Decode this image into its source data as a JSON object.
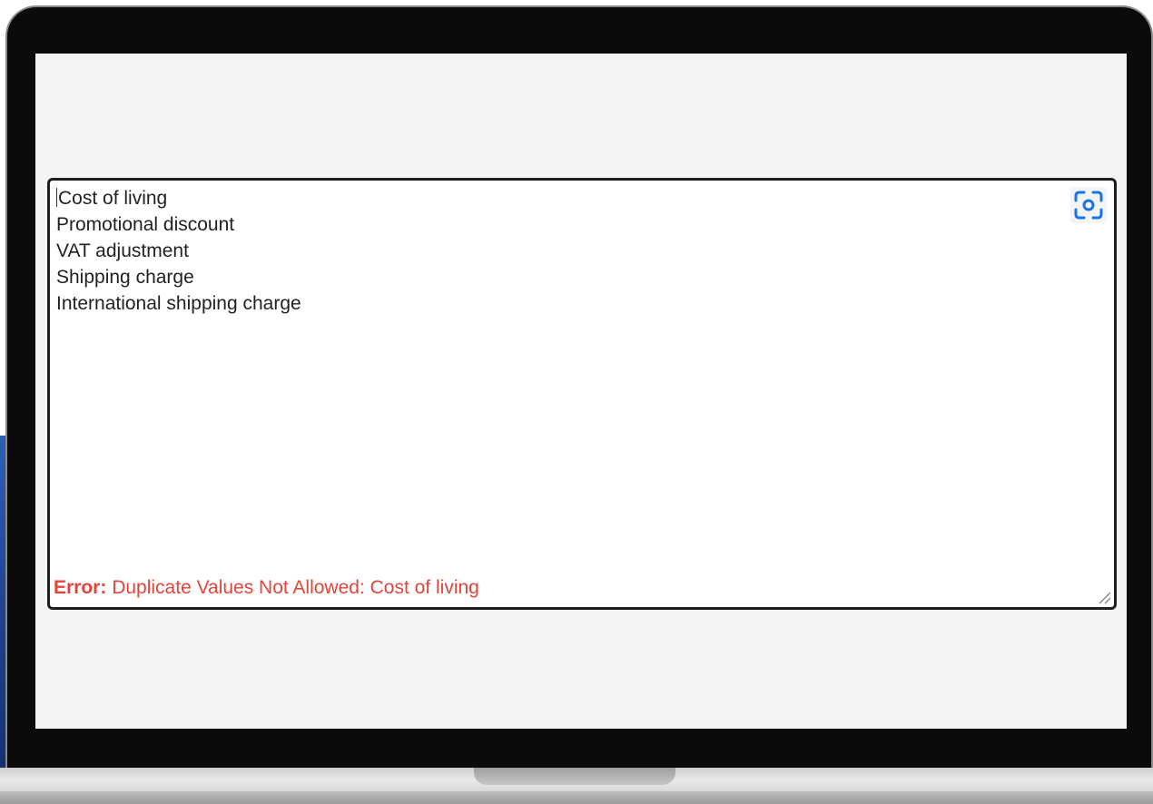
{
  "textarea": {
    "lines": [
      "Cost of living",
      "Promotional discount",
      "VAT adjustment",
      "Shipping charge",
      "International shipping charge"
    ]
  },
  "error": {
    "label": "Error:",
    "message": " Duplicate Values Not Allowed: Cost of living"
  },
  "icons": {
    "scan": "screen-capture-icon",
    "resize": "resize-handle-icon"
  },
  "colors": {
    "error": "#e0453b",
    "icon_accent": "#1a73e8",
    "field_border": "#1e1e1e",
    "screen_background": "#f3f4f5",
    "bezel": "#0b0b0b"
  }
}
